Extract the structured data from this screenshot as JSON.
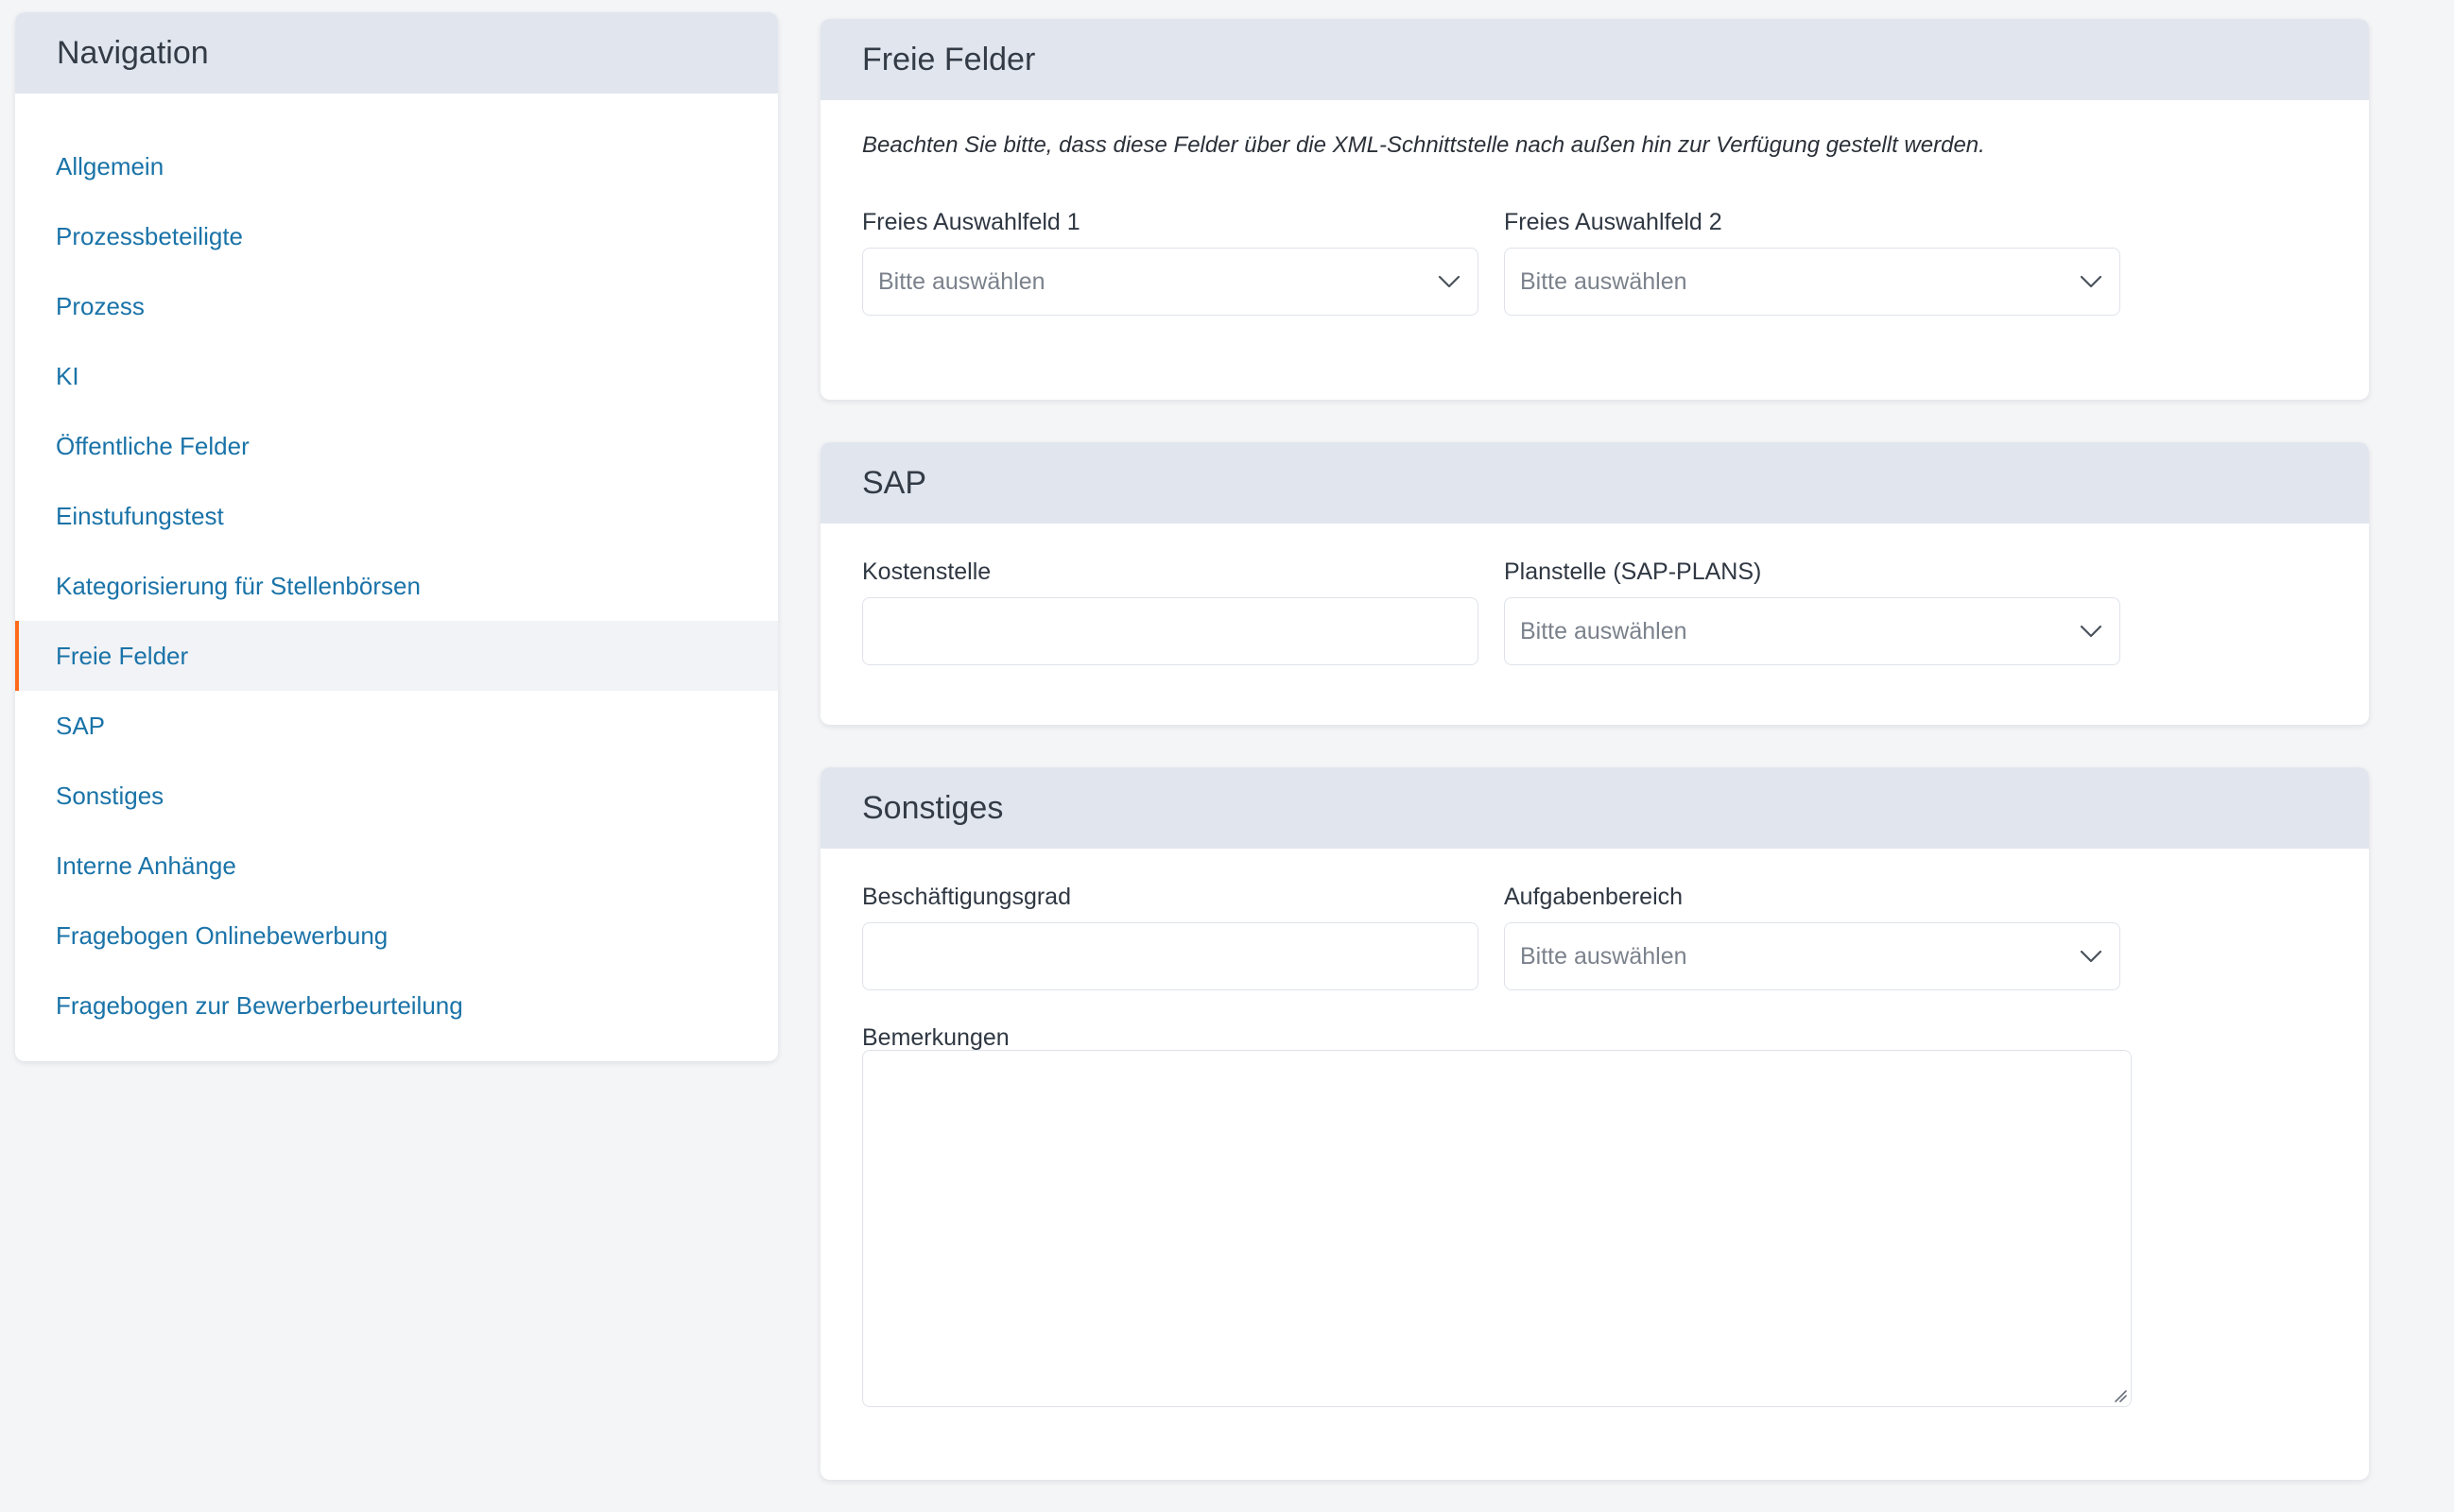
{
  "navigation": {
    "title": "Navigation",
    "active_index": 7,
    "items": [
      {
        "label": "Allgemein"
      },
      {
        "label": "Prozessbeteiligte"
      },
      {
        "label": "Prozess"
      },
      {
        "label": "KI"
      },
      {
        "label": "Öffentliche Felder"
      },
      {
        "label": "Einstufungstest"
      },
      {
        "label": "Kategorisierung für Stellenbörsen"
      },
      {
        "label": "Freie Felder"
      },
      {
        "label": "SAP"
      },
      {
        "label": "Sonstiges"
      },
      {
        "label": "Interne Anhänge"
      },
      {
        "label": "Fragebogen Onlinebewerbung"
      },
      {
        "label": "Fragebogen zur Bewerberbeurteilung"
      }
    ]
  },
  "freie_felder": {
    "title": "Freie Felder",
    "hint": "Beachten Sie bitte, dass diese Felder über die XML-Schnittstelle nach außen hin zur Verfügung gestellt werden.",
    "field1": {
      "label": "Freies Auswahlfeld 1",
      "value": "",
      "placeholder": "Bitte auswählen"
    },
    "field2": {
      "label": "Freies Auswahlfeld 2",
      "value": "",
      "placeholder": "Bitte auswählen"
    }
  },
  "sap": {
    "title": "SAP",
    "kostenstelle": {
      "label": "Kostenstelle",
      "value": ""
    },
    "planstelle": {
      "label": "Planstelle (SAP-PLANS)",
      "value": "",
      "placeholder": "Bitte auswählen"
    }
  },
  "sonstiges": {
    "title": "Sonstiges",
    "beschaeftigungsgrad": {
      "label": "Beschäftigungsgrad",
      "value": ""
    },
    "aufgabenbereich": {
      "label": "Aufgabenbereich",
      "value": "",
      "placeholder": "Bitte auswählen"
    },
    "bemerkungen": {
      "label": "Bemerkungen",
      "value": ""
    }
  },
  "colors": {
    "link": "#1a73a8",
    "active_marker": "#ff6a1a",
    "header_bg": "#e1e6ee",
    "page_bg": "#f4f5f7"
  },
  "icons": {
    "select_indicator": "chevron-down-icon",
    "textarea_resize": "resize-handle-icon"
  }
}
